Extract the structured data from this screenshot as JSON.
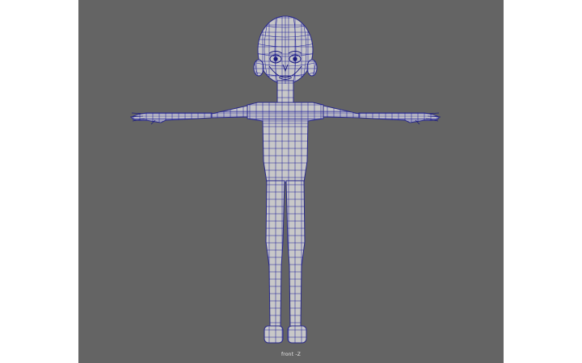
{
  "viewport": {
    "camera_label": "front -Z",
    "background_color": "#646464",
    "mesh_color": "#c8c8c8",
    "wireframe_color": "#1e1e9a"
  },
  "model": {
    "icon": "character-mesh-icon"
  }
}
